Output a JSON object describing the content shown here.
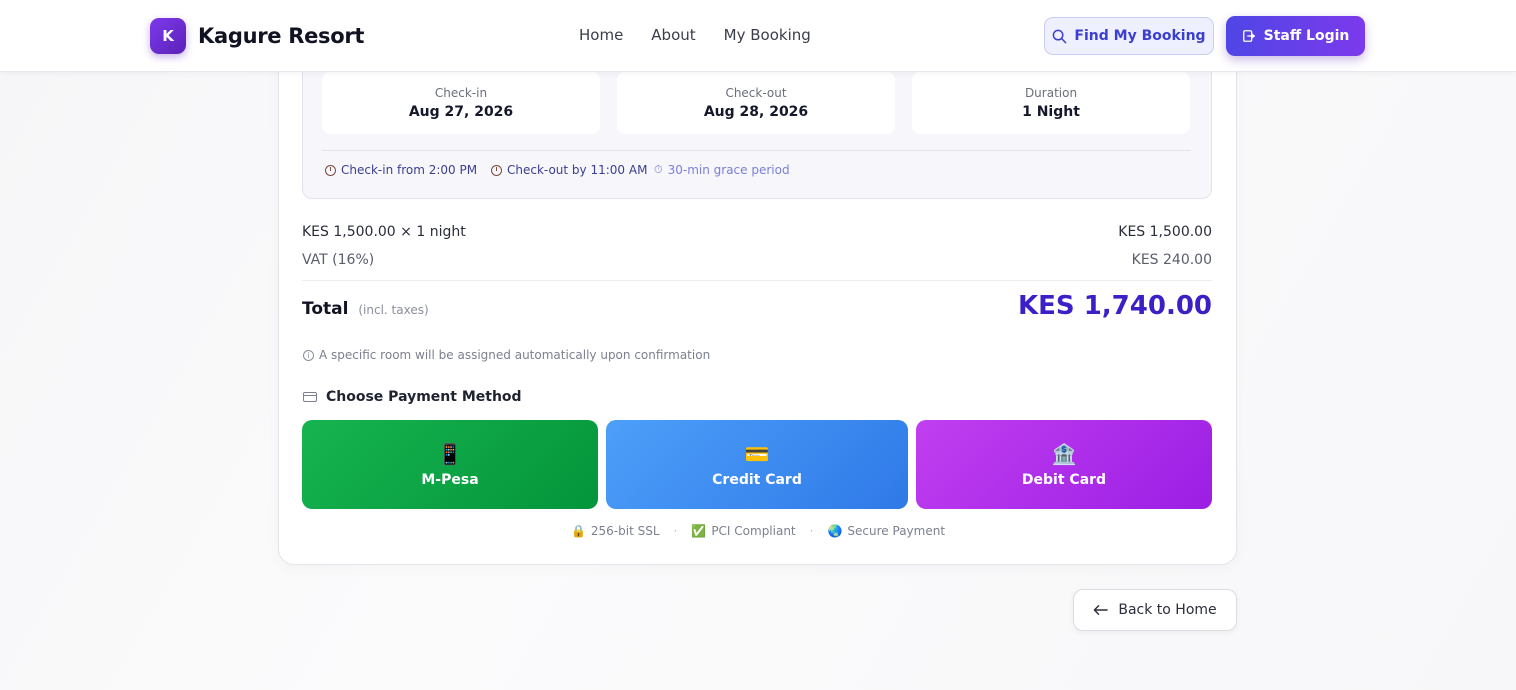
{
  "header": {
    "logo_letter": "K",
    "brand": "Kagure Resort",
    "nav": [
      "Home",
      "About",
      "My Booking"
    ],
    "find_booking": "Find My Booking",
    "staff_login": "Staff Login"
  },
  "stay": {
    "checkin_label": "Check-in",
    "checkin_date": "Aug 27, 2026",
    "checkout_label": "Check-out",
    "checkout_date": "Aug 28, 2026",
    "duration_label": "Duration",
    "duration_value": "1 Night",
    "checkin_policy": "Check-in from 2:00 PM",
    "checkout_policy": "Check-out by 11:00 AM",
    "grace": "30-min grace period"
  },
  "pricing": {
    "rate_line": "KES 1,500.00 × 1 night",
    "rate_amount": "KES 1,500.00",
    "vat_line": "VAT (16%)",
    "vat_amount": "KES 240.00",
    "total_label": "Total",
    "total_note": "(incl. taxes)",
    "total_amount": "KES 1,740.00"
  },
  "room_note": "A specific room will be assigned automatically upon confirmation",
  "payment": {
    "title": "Choose Payment Method",
    "methods": [
      {
        "label": "M-Pesa",
        "icon": "📱"
      },
      {
        "label": "Credit Card",
        "icon": "💳"
      },
      {
        "label": "Debit Card",
        "icon": "🏦"
      }
    ],
    "colors": {
      "mpesa": "#0aa744",
      "credit": "#3b8af2",
      "debit": "#ae2dea"
    }
  },
  "trust": {
    "ssl_icon": "🔒",
    "ssl": "256-bit SSL",
    "pci_icon": "✅",
    "pci": "PCI Compliant",
    "secure_icon": "🌏",
    "secure": "Secure Payment",
    "separator": "·"
  },
  "back_button": "Back to Home",
  "accent_color": "#4f46e5"
}
